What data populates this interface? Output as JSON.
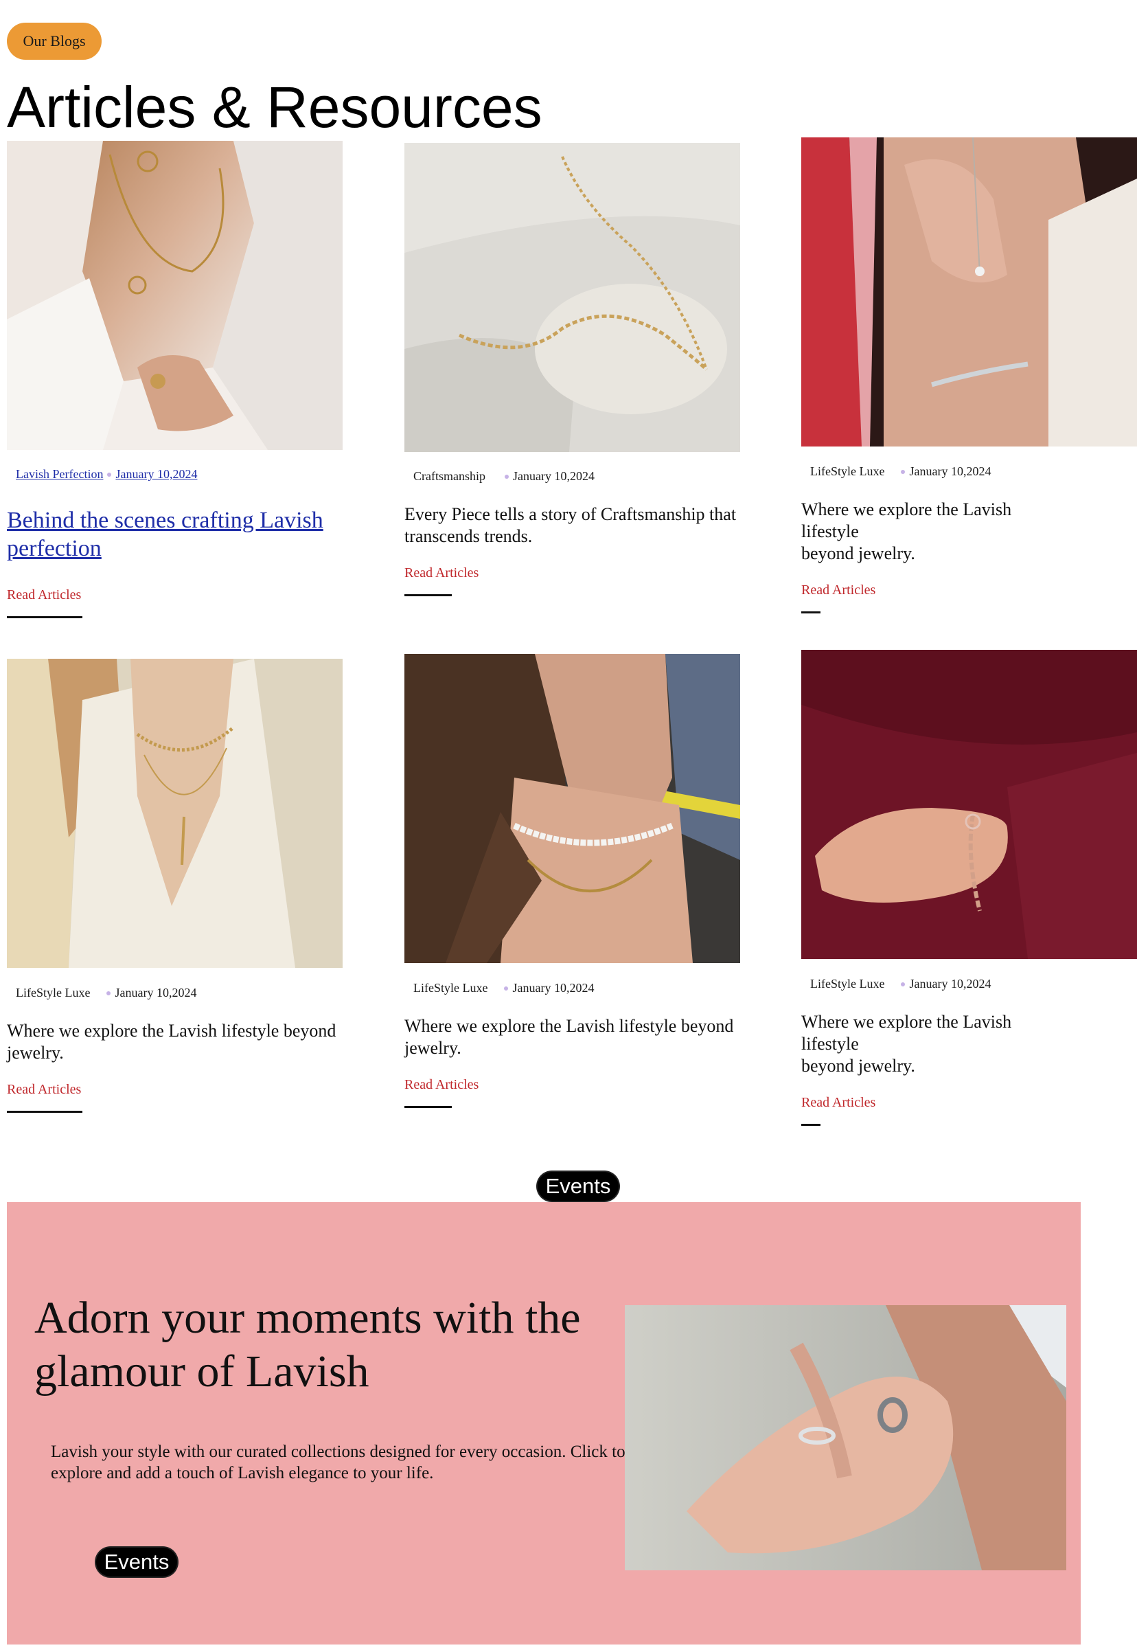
{
  "header": {
    "badge_label": "Our Blogs",
    "title": "Articles & Resources"
  },
  "articles": [
    {
      "category": "Lavish Perfection",
      "date": "January 10,2024",
      "headline": "Behind the scenes crafting Lavish perfection",
      "read_label": "Read Articles",
      "image": "woman-gold-pendant-necklace-photo"
    },
    {
      "category": "Craftsmanship",
      "date": "January 10,2024",
      "headline": "Every Piece tells a story of Craftsmanship that transcends trends.",
      "read_label": "Read Articles",
      "image": "gold-chain-on-fabric-photo"
    },
    {
      "category": "LifeStyle Luxe",
      "date": "January 10,2024",
      "headline_lines": [
        "Where we explore the Lavish",
        "lifestyle",
        "beyond jewelry."
      ],
      "read_label": "Read Articles",
      "image": "woman-silver-bracelet-photo"
    },
    {
      "category": "LifeStyle Luxe",
      "date": "January 10,2024",
      "headline": "Where we explore the Lavish lifestyle beyond jewelry.",
      "read_label": "Read Articles",
      "image": "woman-layered-gold-necklaces-photo"
    },
    {
      "category": "LifeStyle Luxe",
      "date": "January 10,2024",
      "headline": "Where we explore the Lavish lifestyle beyond jewelry.",
      "read_label": "Read Articles",
      "image": "woman-pearl-necklace-photo"
    },
    {
      "category": "LifeStyle Luxe",
      "date": "January 10,2024",
      "headline_lines": [
        "Where we explore the Lavish",
        "lifestyle",
        "beyond jewelry."
      ],
      "read_label": "Read Articles",
      "image": "hand-rose-gold-bracelet-photo"
    }
  ],
  "events": {
    "top_label": "Events",
    "title": "Adorn your moments with the glamour of Lavish",
    "description": "Lavish your style with our curated collections designed for every occasion. Click to explore and add a touch of Lavish elegance to your life.",
    "button_label": "Events",
    "image": "couple-hands-rings-photo"
  },
  "colors": {
    "badge": "#ec9a35",
    "banner": "#f0a9aa",
    "read_link": "#c0282c",
    "link": "#1f2ea8",
    "meta_dot": "#c6b2e6"
  }
}
